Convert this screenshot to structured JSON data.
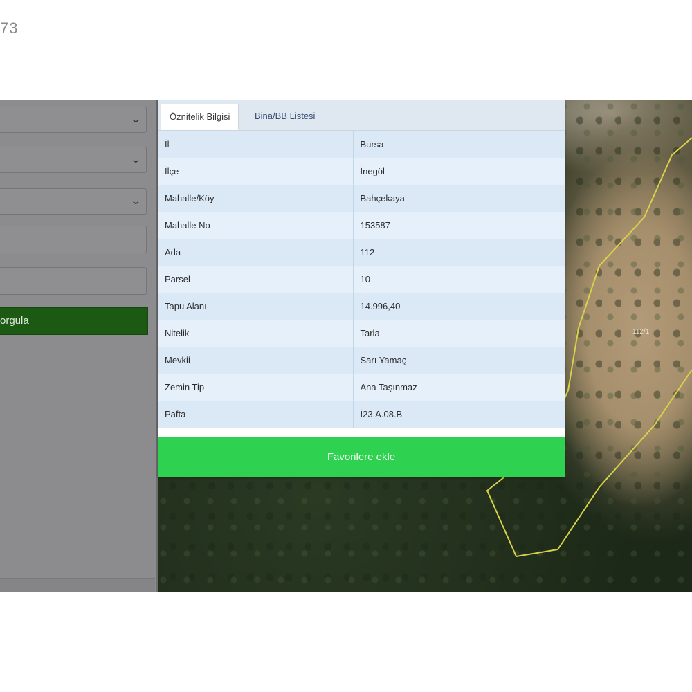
{
  "corner_text": "73",
  "left_panel": {
    "query_button_label": "orgula"
  },
  "dialog": {
    "tabs": [
      {
        "label": "Öznitelik Bilgisi",
        "active": true
      },
      {
        "label": "Bina/BB Listesi",
        "active": false
      }
    ],
    "rows": [
      {
        "key": "İl",
        "value": "Bursa"
      },
      {
        "key": "İlçe",
        "value": "İnegöl"
      },
      {
        "key": "Mahalle/Köy",
        "value": "Bahçekaya"
      },
      {
        "key": "Mahalle No",
        "value": "153587"
      },
      {
        "key": "Ada",
        "value": "112"
      },
      {
        "key": "Parsel",
        "value": "10"
      },
      {
        "key": "Tapu Alanı",
        "value": "14.996,40"
      },
      {
        "key": "Nitelik",
        "value": "Tarla"
      },
      {
        "key": "Mevkii",
        "value": "Sarı Yamaç"
      },
      {
        "key": "Zemin Tip",
        "value": "Ana Taşınmaz"
      },
      {
        "key": "Pafta",
        "value": "İ23.A.08.B"
      }
    ],
    "favorite_button_label": "Favorilere ekle"
  },
  "map": {
    "parcel_label": "112/1",
    "parcel_outline_color": "#d8d24a"
  },
  "icons": {
    "dropdown_chevron": "chevron-down-icon"
  }
}
